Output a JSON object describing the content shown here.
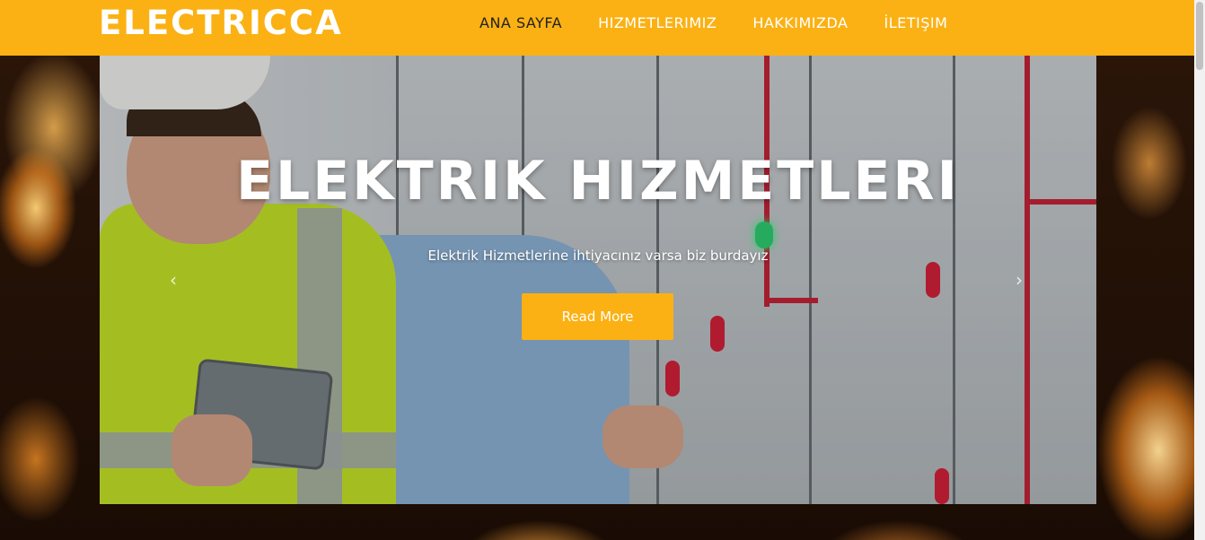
{
  "header": {
    "brand": "ELECTRICCA",
    "nav": [
      {
        "label": "ANA SAYFA",
        "active": true
      },
      {
        "label": "HIZMETLERIMIZ",
        "active": false
      },
      {
        "label": "HAKKIMIZDA",
        "active": false
      },
      {
        "label": "İLETIŞIM",
        "active": false
      }
    ]
  },
  "hero": {
    "title": "ELEKTRIK HIZMETLERI",
    "subtitle": "Elektrik Hizmetlerine ihtiyacınız varsa biz burdayız",
    "button_label": "Read More",
    "prev_arrow": "‹",
    "next_arrow": "›"
  },
  "colors": {
    "accent": "#fbb113",
    "header_bg": "#fbb113",
    "active_nav": "#222222",
    "text_light": "#ffffff"
  },
  "icons": {
    "prev": "chevron-left-icon",
    "next": "chevron-right-icon"
  }
}
